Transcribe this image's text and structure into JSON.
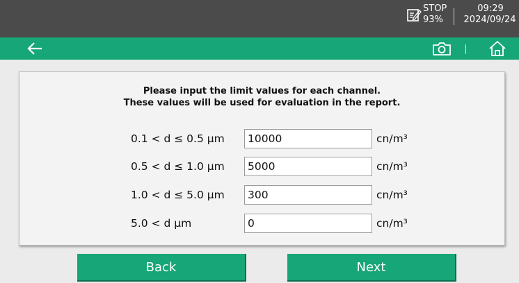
{
  "status": {
    "run_state": "STOP",
    "battery": "93%",
    "time": "09:29",
    "date": "2024/09/24"
  },
  "toolbar": {
    "back_icon": "arrow-left-icon",
    "camera_icon": "camera-icon",
    "home_icon": "home-icon"
  },
  "form": {
    "instruction_line1": "Please input the limit values for each channel.",
    "instruction_line2": "These values will be used for evaluation in the report.",
    "rows": [
      {
        "label": "0.1 < d ≤ 0.5 µm",
        "value": "10000",
        "unit": "cn/m³"
      },
      {
        "label": "0.5 < d ≤ 1.0 µm",
        "value": "5000",
        "unit": "cn/m³"
      },
      {
        "label": "1.0 < d ≤ 5.0 µm",
        "value": "300",
        "unit": "cn/m³"
      },
      {
        "label": "5.0 < d µm",
        "value": "0",
        "unit": "cn/m³"
      }
    ]
  },
  "buttons": {
    "back_label": "Back",
    "next_label": "Next"
  },
  "colors": {
    "accent": "#17a677",
    "status_bar": "#4b4b4b",
    "background": "#ebebeb"
  }
}
